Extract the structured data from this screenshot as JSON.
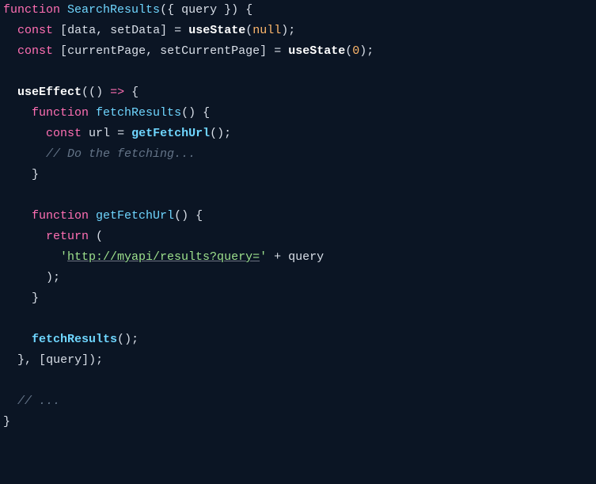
{
  "code": {
    "l1": {
      "kw": "function",
      "name": "SearchResults",
      "p1": "(",
      "lb": "{",
      "sp": " ",
      "param": "query",
      "rb": "}",
      "p2": ")",
      "ob": "{"
    },
    "l2": {
      "kw": "const",
      "lb": "[",
      "id1": "data",
      "c": ",",
      "sp": " ",
      "id2": "setData",
      "rb": "]",
      "eq": "=",
      "hook": "useState",
      "p1": "(",
      "arg": "null",
      "p2": ")",
      "sc": ";"
    },
    "l3": {
      "kw": "const",
      "lb": "[",
      "id1": "currentPage",
      "c": ",",
      "sp": " ",
      "id2": "setCurrentPage",
      "rb": "]",
      "eq": "=",
      "hook": "useState",
      "p1": "(",
      "arg": "0",
      "p2": ")",
      "sc": ";"
    },
    "l5": {
      "hook": "useEffect",
      "p1": "(",
      "p2": "(",
      "p3": ")",
      "arrow": "=>",
      "ob": "{"
    },
    "l6": {
      "kw": "function",
      "name": "fetchResults",
      "p1": "(",
      "p2": ")",
      "ob": "{"
    },
    "l7": {
      "kw": "const",
      "id": "url",
      "eq": "=",
      "call": "getFetchUrl",
      "p1": "(",
      "p2": ")",
      "sc": ";"
    },
    "l8": {
      "cmt": "// Do the fetching..."
    },
    "l9": {
      "cb": "}"
    },
    "l11": {
      "kw": "function",
      "name": "getFetchUrl",
      "p1": "(",
      "p2": ")",
      "ob": "{"
    },
    "l12": {
      "kw": "return",
      "p1": "("
    },
    "l13": {
      "q1": "'",
      "url": "http://myapi/results?query=",
      "q2": "'",
      "plus": "+",
      "id": "query"
    },
    "l14": {
      "p1": ")",
      "sc": ";"
    },
    "l15": {
      "cb": "}"
    },
    "l17": {
      "call": "fetchResults",
      "p1": "(",
      "p2": ")",
      "sc": ";"
    },
    "l18": {
      "cb": "}",
      "c": ",",
      "sp": " ",
      "lb": "[",
      "id": "query",
      "rb": "]",
      "p2": ")",
      "sc": ";"
    },
    "l20": {
      "cmt": "// ..."
    },
    "l21": {
      "cb": "}"
    }
  }
}
